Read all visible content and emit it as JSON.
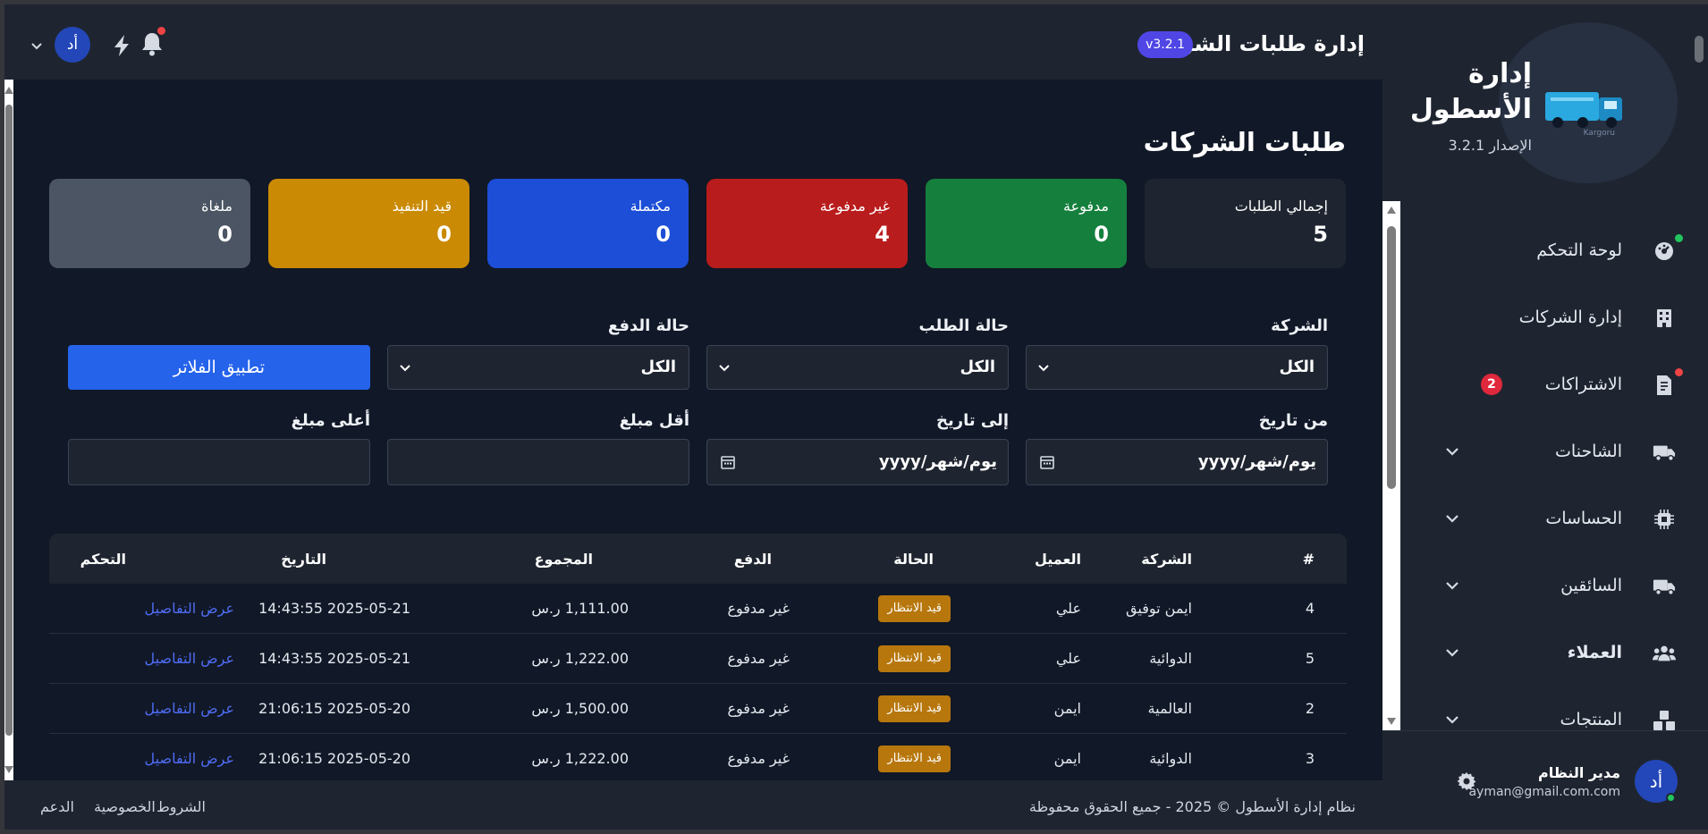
{
  "header": {
    "title": "إدارة طلبات الشركات",
    "version_badge": "v3.2.1",
    "avatar_initials": "أد"
  },
  "sidebar": {
    "brand_title": "إدارة الأسطول",
    "brand_version": "الإصدار 3.2.1",
    "logo_alt": "Kargoru",
    "items": [
      {
        "label": "لوحة التحكم",
        "icon": "dashboard-icon"
      },
      {
        "label": "إدارة الشركات",
        "icon": "building-icon"
      },
      {
        "label": "الاشتراكات",
        "icon": "file-invoice-icon",
        "badge": "2"
      },
      {
        "label": "الشاحنات",
        "icon": "truck-icon"
      },
      {
        "label": "الحساسات",
        "icon": "chip-icon"
      },
      {
        "label": "السائقين",
        "icon": "truck-icon"
      },
      {
        "label": "العملاء",
        "icon": "users-icon"
      },
      {
        "label": "المنتجات",
        "icon": "boxes-icon"
      }
    ],
    "user": {
      "initials": "أد",
      "name": "مدير النظام",
      "email": "ayman@gmail.com.com"
    }
  },
  "main": {
    "page_title": "طلبات الشركات",
    "stats": [
      {
        "label": "إجمالي الطلبات",
        "value": "5",
        "color": "#1f2530"
      },
      {
        "label": "مدفوعة",
        "value": "0",
        "color": "#15803d"
      },
      {
        "label": "غير مدفوعة",
        "value": "4",
        "color": "#b91c1c"
      },
      {
        "label": "مكتملة",
        "value": "0",
        "color": "#1d4ed8"
      },
      {
        "label": "قيد التنفيذ",
        "value": "0",
        "color": "#ca8a04"
      },
      {
        "label": "ملغاة",
        "value": "0",
        "color": "#4b5563"
      }
    ],
    "filters": {
      "company_label": "الشركة",
      "company_value": "الكل",
      "order_status_label": "حالة الطلب",
      "order_status_value": "الكل",
      "payment_status_label": "حالة الدفع",
      "payment_status_value": "الكل",
      "apply_label": "تطبيق الفلاتر",
      "from_date_label": "من تاريخ",
      "from_date_value": "يوم/شهر/yyyy",
      "to_date_label": "إلى تاريخ",
      "to_date_value": "يوم/شهر/yyyy",
      "min_amount_label": "أقل مبلغ",
      "max_amount_label": "أعلى مبلغ"
    },
    "table": {
      "columns": [
        "#",
        "الشركة",
        "العميل",
        "الحالة",
        "الدفع",
        "المجموع",
        "التاريخ",
        "التحكم"
      ],
      "rows": [
        {
          "id": "4",
          "company": "ايمن توفيق",
          "client": "علي",
          "status": "قيد الانتظار",
          "payment": "غير مدفوع",
          "total": "1,111.00 ر.س",
          "date": "2025-05-21 14:43:55",
          "action": "عرض التفاصيل"
        },
        {
          "id": "5",
          "company": "الدوائية",
          "client": "علي",
          "status": "قيد الانتظار",
          "payment": "غير مدفوع",
          "total": "1,222.00 ر.س",
          "date": "2025-05-21 14:43:55",
          "action": "عرض التفاصيل"
        },
        {
          "id": "2",
          "company": "العالمية",
          "client": "ايمن",
          "status": "قيد الانتظار",
          "payment": "غير مدفوع",
          "total": "1,500.00 ر.س",
          "date": "2025-05-20 21:06:15",
          "action": "عرض التفاصيل"
        },
        {
          "id": "3",
          "company": "الدوائية",
          "client": "ايمن",
          "status": "قيد الانتظار",
          "payment": "غير مدفوع",
          "total": "1,222.00 ر.س",
          "date": "2025-05-20 21:06:15",
          "action": "عرض التفاصيل"
        }
      ]
    }
  },
  "footer": {
    "copyright": "نظام إدارة الأسطول © 2025 - جميع الحقوق محفوظة",
    "links": [
      "الشروط",
      "الخصوصية",
      "الدعم"
    ]
  }
}
